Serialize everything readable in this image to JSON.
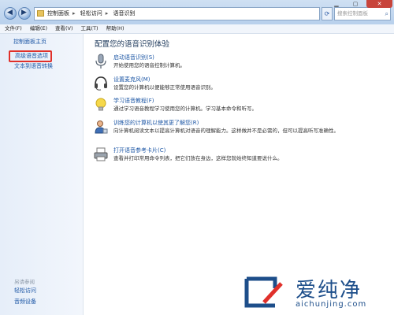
{
  "nav": {
    "breadcrumbs": [
      "控制面板",
      "轻松访问",
      "语音识别"
    ],
    "search_placeholder": "搜索控制面板"
  },
  "menubar": [
    "文件(F)",
    "编辑(E)",
    "查看(V)",
    "工具(T)",
    "帮助(H)"
  ],
  "sidebar": {
    "home": "控制面板主页",
    "advanced": "高级语音选项",
    "tts": "文本到语音转换",
    "see_also_title": "另请参阅",
    "see_also": [
      "轻松访问",
      "音频设备"
    ]
  },
  "main": {
    "title": "配置您的语音识别体验",
    "items": [
      {
        "icon": "microphone-icon",
        "link": "启动语音识别(S)",
        "desc": "开始使用您的语音控制计算机。"
      },
      {
        "icon": "headset-icon",
        "link": "设置麦克风(M)",
        "desc": "设置您的计算机以便能够正常使用语音识别。"
      },
      {
        "icon": "lightbulb-icon",
        "link": "学习语音教程(F)",
        "desc": "通过学习语音教程学习使用您的计算机。学习基本命令和听写。"
      },
      {
        "icon": "user-icon",
        "link": "训练您的计算机以使其更了解您(R)",
        "desc": "向计算机阅读文本以提高计算机对语音的理解能力。这样做并不是必需的，但可以提高听写准确性。"
      },
      {
        "icon": "printer-icon",
        "link": "打开语音参考卡片(C)",
        "desc": "查看并打印常用命令列表，把它们放在身边，这样您就始终知道要说什么。"
      }
    ]
  },
  "watermark": {
    "brand": "爱纯净",
    "url": "aichunjing.com"
  },
  "colors": {
    "link": "#1f58a6",
    "highlight_border": "#e0302a",
    "sidebar_bg": "#e6eef9",
    "brand": "#1d4e8a"
  }
}
